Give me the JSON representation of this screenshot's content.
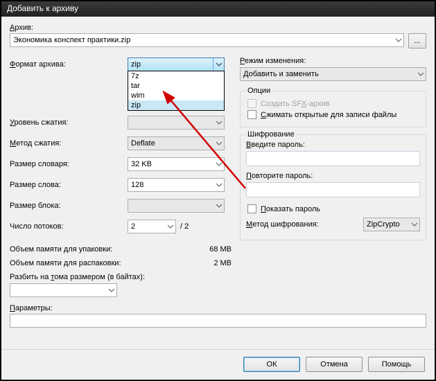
{
  "window": {
    "title": "Добавить к архиву"
  },
  "archive": {
    "label_first": "А",
    "label_rest": "рхив:",
    "value": "Экономика конспект практики.zip",
    "browse": "..."
  },
  "left": {
    "format_label_first": "Ф",
    "format_label_rest": "ормат архива:",
    "format_value": "zip",
    "format_options": [
      "7z",
      "tar",
      "wim",
      "zip"
    ],
    "level_label_first": "У",
    "level_label_rest": "ровень сжатия:",
    "level_value": "",
    "method_label_first": "М",
    "method_label_rest": "етод сжатия:",
    "method_value": "Deflate",
    "dict_label": "Размер словаря:",
    "dict_value": "32 KB",
    "word_label": "Размер слова:",
    "word_value": "128",
    "block_label": "Размер блока:",
    "block_value": "",
    "threads_label": "Число потоков:",
    "threads_value": "2",
    "threads_suffix": "/ 2",
    "mem_pack_label": "Объем памяти для упаковки:",
    "mem_pack_value": "68 MB",
    "mem_unpack_label": "Объем памяти для распаковки:",
    "mem_unpack_value": "2 MB",
    "split_label_p1": "Разбить на ",
    "split_label_first": "т",
    "split_label_p2": "ома размером (в байтах):",
    "split_value": ""
  },
  "right": {
    "mode_label_first": "Р",
    "mode_label_rest": "ежим изменения:",
    "mode_value_first": "Д",
    "mode_value_rest": "обавить и заменить",
    "options_legend": "Опции",
    "sfx_label_p1": "Создать SF",
    "sfx_label_first": "X",
    "sfx_label_p2": "-архив",
    "shared_label_first": "С",
    "shared_label_rest": "жимать открытые для записи файлы",
    "enc_legend": "Шифрование",
    "pass1_label_first": "В",
    "pass1_label_rest": "ведите пароль:",
    "pass2_label_first": "П",
    "pass2_label_rest": "овторите пароль:",
    "showpass_label_first": "П",
    "showpass_label_rest": "оказать пароль",
    "encmethod_label_first": "М",
    "encmethod_label_rest": "етод шифрования:",
    "encmethod_value": "ZipCrypto"
  },
  "params": {
    "label_first": "П",
    "label_rest": "араметры:",
    "value": ""
  },
  "footer": {
    "ok": "ОК",
    "cancel": "Отмена",
    "help": "Помощь"
  }
}
